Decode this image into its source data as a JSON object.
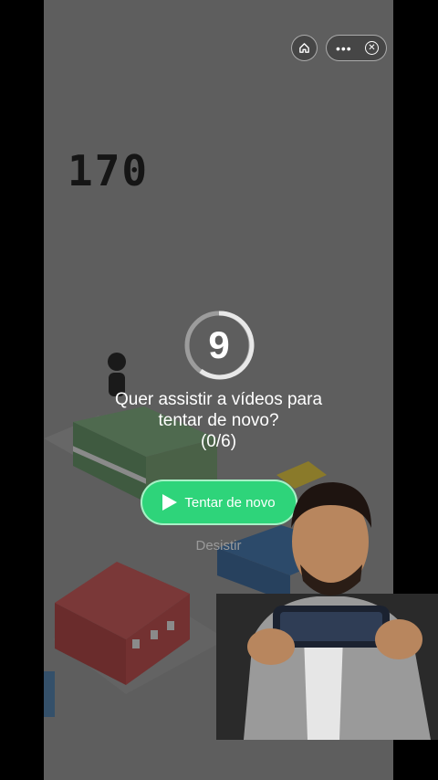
{
  "capsule": {
    "home_icon": "home-icon",
    "more_icon": "more-dots-icon",
    "close_icon": "close-circle-icon"
  },
  "game": {
    "score": "170"
  },
  "dialog": {
    "timer": "9",
    "question_line1": "Quer assistir a vídeos para",
    "question_line2": "tentar de novo?",
    "progress": "(0/6)",
    "retry_label": "Tentar de novo",
    "giveup_label": "Desistir"
  },
  "colors": {
    "overlay": "#5e5e5e",
    "button": "#2ed47a"
  }
}
